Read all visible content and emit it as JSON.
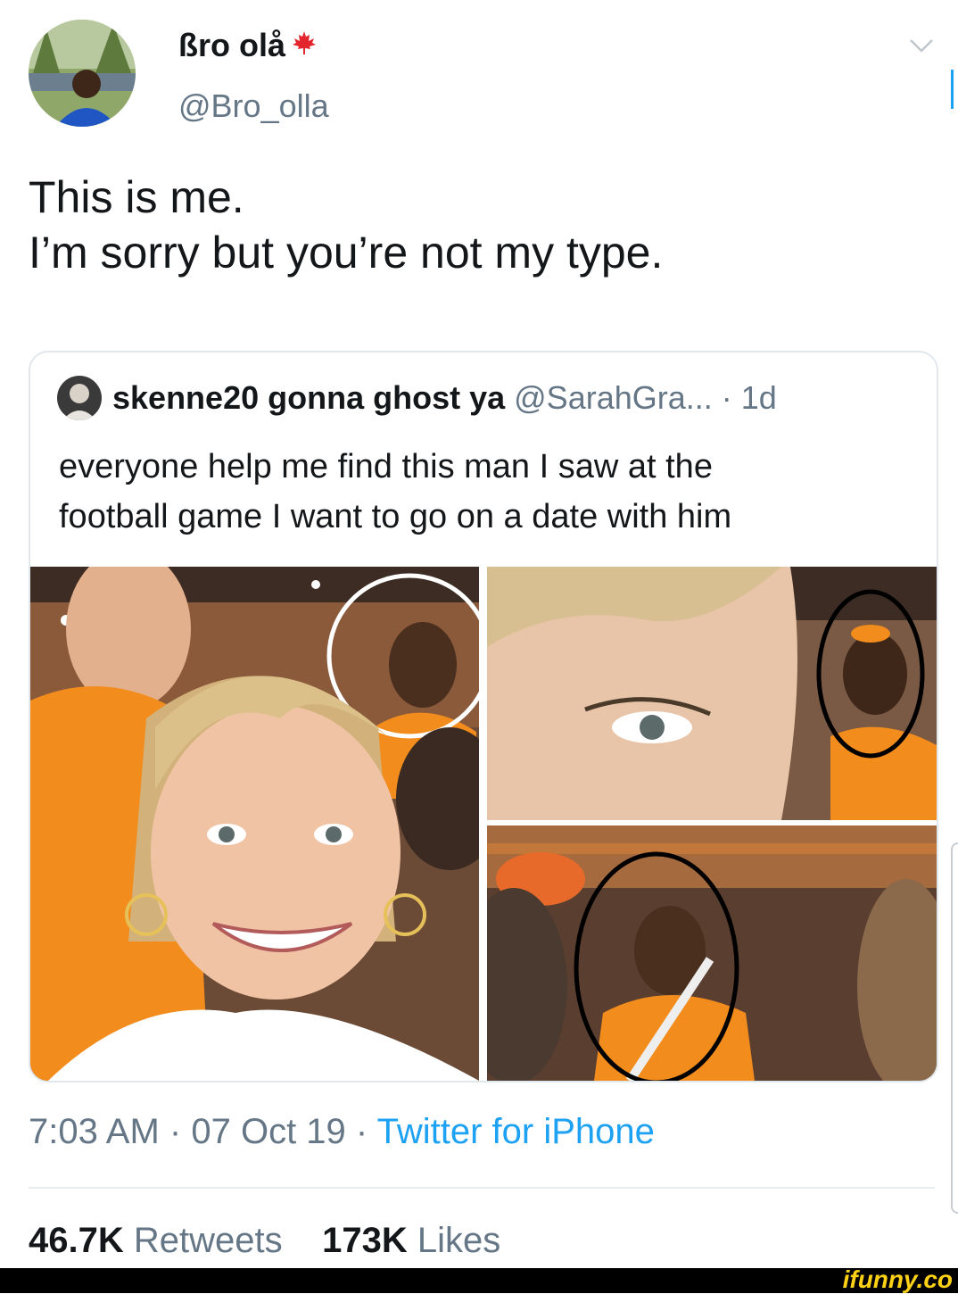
{
  "author": {
    "display_name": "ßro olå",
    "flag_icon": "maple-leaf-icon",
    "handle": "@Bro_olla"
  },
  "tweet": {
    "lines": [
      "This is me.",
      "I’m sorry but you’re not my type."
    ]
  },
  "quoted_tweet": {
    "name": "skenne20 gonna ghost ya",
    "handle": "@SarahGra...",
    "time": "· 1d",
    "lines": [
      "everyone help me find this man I saw at the",
      "football game I want to go on a date with him"
    ]
  },
  "meta": {
    "time": "7:03 AM",
    "date": "07 Oct 19",
    "separator": "·",
    "source": "Twitter for iPhone"
  },
  "stats": {
    "retweets_count": "46.7K",
    "retweets_label": "Retweets",
    "likes_count": "173K",
    "likes_label": "Likes"
  },
  "watermark": "ifunny.co",
  "colors": {
    "link": "#1da1f2",
    "secondary": "#657786",
    "maple": "#e3262e",
    "jersey": "#f28c1c"
  }
}
